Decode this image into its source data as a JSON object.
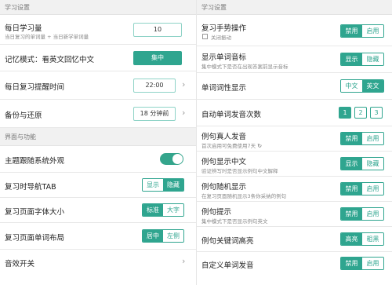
{
  "left": {
    "section_study": "学习设置",
    "daily_goal": {
      "title": "每日学习量",
      "subtitle": "当日复习的单词量 + 当日新学单词量",
      "value": "10"
    },
    "memory_mode": {
      "title": "记忆模式：看英文回忆中文",
      "value": "集中"
    },
    "reminder": {
      "title": "每日复习提醒时间",
      "value": "22:00"
    },
    "backup": {
      "title": "备份与还原",
      "value": "18 分钟前"
    },
    "section_ui": "界面与功能",
    "theme": {
      "title": "主题跟随系统外观",
      "on": true
    },
    "nav_tab": {
      "title": "复习时导航TAB",
      "options": [
        "显示",
        "隐藏"
      ],
      "selected": 1
    },
    "font_size": {
      "title": "复习页面字体大小",
      "options": [
        "标准",
        "大字"
      ],
      "selected": 0
    },
    "layout": {
      "title": "复习页面单词布局",
      "options": [
        "居中",
        "左侧"
      ],
      "selected": 0
    },
    "sound": {
      "title": "音效开关"
    }
  },
  "right": {
    "section_study": "学习设置",
    "gesture": {
      "title": "复习手势操作",
      "checkbox_label": "关闭振动",
      "options": [
        "禁用",
        "启用"
      ],
      "selected": 0
    },
    "phonetic": {
      "title": "显示单词音标",
      "subtitle": "集中模式下是否在出现答案前显示音标",
      "options": [
        "显示",
        "隐藏"
      ],
      "selected": 0
    },
    "pos": {
      "title": "单词词性显示",
      "options": [
        "中文",
        "英文"
      ],
      "selected": 1
    },
    "repeat": {
      "title": "自动单词发音次数",
      "options": [
        "1",
        "2",
        "3"
      ],
      "selected": 0
    },
    "voice": {
      "title": "例句真人发音",
      "subtitle": "首次启用可免费使用7天",
      "refresh_icon": "↻",
      "options": [
        "禁用",
        "启用"
      ],
      "selected": 0
    },
    "sentence_cn": {
      "title": "例句显示中文",
      "subtitle": "验证辨写时是否显示例句中文解释",
      "options": [
        "显示",
        "隐藏"
      ],
      "selected": 0
    },
    "random_sentence": {
      "title": "例句随机显示",
      "subtitle": "在复习页面随机显示3条你采纳的例句",
      "options": [
        "禁用",
        "启用"
      ],
      "selected": 0
    },
    "hint": {
      "title": "例句提示",
      "subtitle": "集中模式下是否显示例句英文",
      "options": [
        "禁用",
        "启用"
      ],
      "selected": 0
    },
    "keyword": {
      "title": "例句关键词高亮",
      "options": [
        "高亮",
        "粗黑"
      ],
      "selected": 0
    },
    "custom_voice": {
      "title": "自定义单词发音",
      "options": [
        "禁用",
        "启用"
      ],
      "selected": 0
    }
  },
  "colors": {
    "accent": "#2fa58f",
    "toggle_on": "#34a58c",
    "section_bg": "#f1f1f1"
  },
  "icons": {
    "chevron": "chevron-right-icon",
    "refresh": "refresh-icon"
  }
}
